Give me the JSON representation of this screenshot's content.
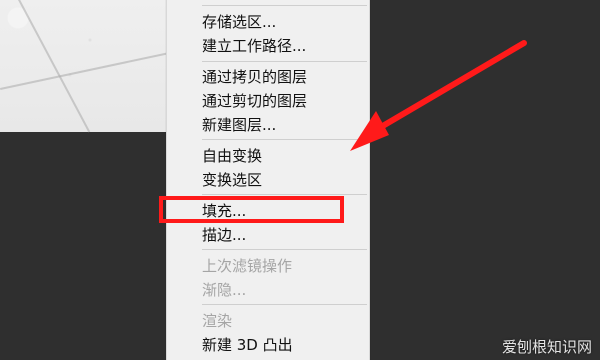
{
  "menu": {
    "items": [
      {
        "label": "存储选区...",
        "enabled": true
      },
      {
        "label": "建立工作路径...",
        "enabled": true
      },
      {
        "label": "通过拷贝的图层",
        "enabled": true
      },
      {
        "label": "通过剪切的图层",
        "enabled": true
      },
      {
        "label": "新建图层...",
        "enabled": true
      },
      {
        "label": "自由变换",
        "enabled": true
      },
      {
        "label": "变换选区",
        "enabled": true
      },
      {
        "label": "填充...",
        "enabled": true
      },
      {
        "label": "描边...",
        "enabled": true
      },
      {
        "label": "上次滤镜操作",
        "enabled": false
      },
      {
        "label": "渐隐...",
        "enabled": false
      },
      {
        "label": "渲染",
        "enabled": false
      },
      {
        "label": "新建 3D 凸出",
        "enabled": true
      }
    ]
  },
  "annotation": {
    "highlight_color": "#ff1a1a",
    "arrow_color": "#ff1a1a"
  },
  "watermark": {
    "text": "爱刨根知识网"
  }
}
